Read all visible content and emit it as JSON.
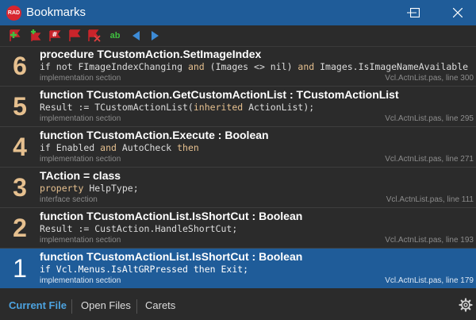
{
  "window": {
    "title": "Bookmarks",
    "logo_text": "RAD",
    "controls": [
      "minimize-icon",
      "maximize-icon",
      "close-icon"
    ]
  },
  "toolbar": {
    "buttons": [
      "add-bookmark-icon",
      "add-bookmark-plus-icon",
      "numbered-bookmark-icon",
      "flag-bookmark-icon",
      "delete-bookmark-icon"
    ],
    "ab_label": "ab",
    "nav": [
      "prev-arrow-icon",
      "next-arrow-icon"
    ]
  },
  "bookmarks": [
    {
      "num": "6",
      "header": "procedure TCustomAction.SetImageIndex",
      "code": [
        [
          "",
          "if not FImageIndexChanging "
        ],
        [
          "kw",
          "and"
        ],
        [
          "",
          " (Images <> nil) "
        ],
        [
          "kw",
          "and"
        ],
        [
          "",
          " Images.IsImageNameAvailable then"
        ]
      ],
      "section": "implementation section",
      "file": "Vcl.ActnList.pas, line 300",
      "selected": false
    },
    {
      "num": "5",
      "header": "function TCustomAction.GetCustomActionList : TCustomActionList",
      "code": [
        [
          "",
          "Result := TCustomActionList("
        ],
        [
          "kw",
          "inherited"
        ],
        [
          "",
          " ActionList);"
        ]
      ],
      "section": "implementation section",
      "file": "Vcl.ActnList.pas, line 295",
      "selected": false
    },
    {
      "num": "4",
      "header": "function TCustomAction.Execute : Boolean",
      "code": [
        [
          "",
          "if Enabled "
        ],
        [
          "kw",
          "and"
        ],
        [
          "",
          " AutoCheck "
        ],
        [
          "kw",
          "then"
        ]
      ],
      "section": "implementation section",
      "file": "Vcl.ActnList.pas, line 271",
      "selected": false
    },
    {
      "num": "3",
      "header": "TAction = class",
      "code": [
        [
          "kw",
          "property"
        ],
        [
          "",
          " HelpType;"
        ]
      ],
      "section": "interface section",
      "file": "Vcl.ActnList.pas, line 111",
      "selected": false
    },
    {
      "num": "2",
      "header": "function TCustomActionList.IsShortCut : Boolean",
      "code": [
        [
          "",
          "Result := CustAction.HandleShortCut;"
        ]
      ],
      "section": "implementation section",
      "file": "Vcl.ActnList.pas, line 193",
      "selected": false
    },
    {
      "num": "1",
      "header": "function TCustomActionList.IsShortCut : Boolean",
      "code": [
        [
          "",
          "if Vcl.Menus.IsAltGRPressed then Exit;"
        ]
      ],
      "section": "implementation section",
      "file": "Vcl.ActnList.pas, line 179",
      "selected": true
    }
  ],
  "tabs": [
    {
      "label": "Current File",
      "active": true
    },
    {
      "label": "Open Files",
      "active": false
    },
    {
      "label": "Carets",
      "active": false
    }
  ],
  "settings_icon": "gear-icon",
  "colors": {
    "titlebar": "#1f5c99",
    "background": "#2b2b2b",
    "selection": "#1f5c99",
    "number": "#e6c08f",
    "keyword": "#e6c08f",
    "active_tab": "#4da3e0"
  }
}
